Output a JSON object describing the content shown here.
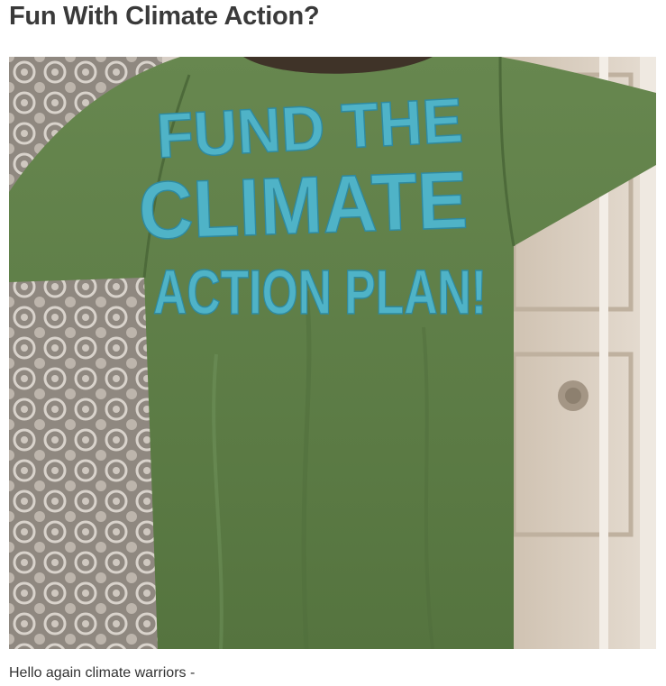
{
  "post": {
    "title": "Fun With Climate Action?",
    "intro_text": "Hello again climate warriors -"
  },
  "photo": {
    "alt": "Green t-shirt hand-painted with a climate slogan",
    "shirt_text_line1": "FUND THE",
    "shirt_text_line2": "CLIMATE",
    "shirt_text_line3": "ACTION PLAN!",
    "shirt_color": "#5e7e4c",
    "paint_color": "#4fb3c7"
  }
}
